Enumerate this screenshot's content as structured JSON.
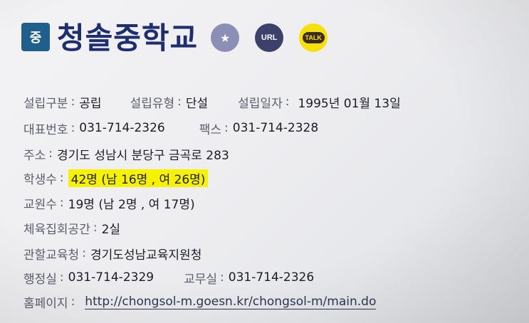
{
  "school": {
    "badge": "중",
    "name": "청솔중학교"
  },
  "icons": {
    "url_label": "URL",
    "talk_label": "TALK"
  },
  "info": {
    "colon": ":",
    "type_label": "설립구분",
    "type_value": "공립",
    "kind_label": "설립유형",
    "kind_value": "단설",
    "date_label": "설립일자",
    "date_value": "1995년 01월 13일",
    "phone_label": "대표번호",
    "phone_value": "031-714-2326",
    "fax_label": "팩스",
    "fax_value": "031-714-2328",
    "address_label": "주소",
    "address_value": "경기도 성남시 분당구 금곡로 283",
    "students_label": "학생수",
    "students_value": "42명 (남 16명 , 여 26명)",
    "teachers_label": "교원수",
    "teachers_value": "19명 (남 2명 , 여 17명)",
    "gym_label": "체육집회공간",
    "gym_value": "2실",
    "office_label": "관할교육청",
    "office_value": "경기도성남교육지원청",
    "admin_label": "행정실",
    "admin_value": "031-714-2329",
    "staff_label": "교무실",
    "staff_value": "031-714-2326",
    "homepage_label": "홈페이지",
    "homepage_value": "http://chongsol-m.goesn.kr/chongsol-m/main.do"
  }
}
